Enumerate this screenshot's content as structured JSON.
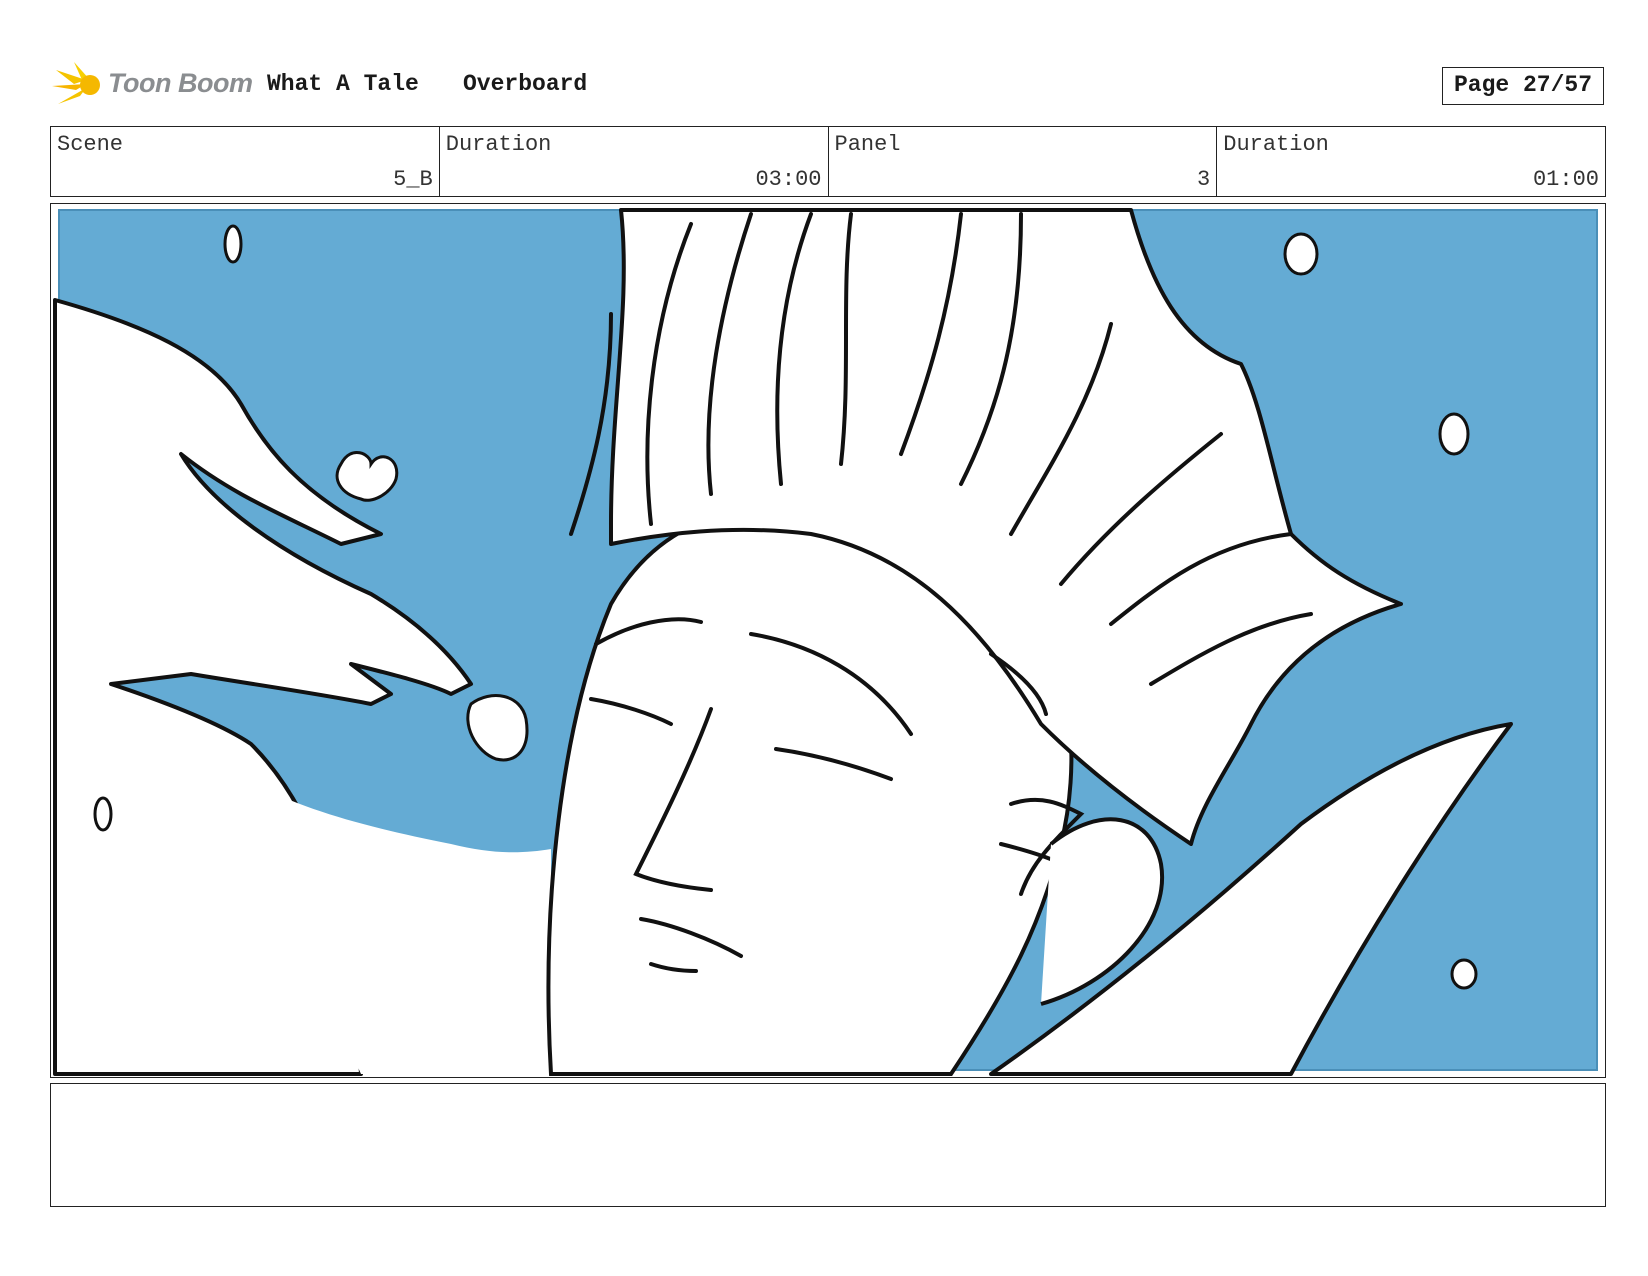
{
  "header": {
    "logo_text": "Toon Boom",
    "project_title": "What A Tale",
    "episode_title": "Overboard",
    "page_label": "Page 27/57"
  },
  "info": {
    "scene_label": "Scene",
    "scene_value": "5_B",
    "scene_duration_label": "Duration",
    "scene_duration_value": "03:00",
    "panel_label": "Panel",
    "panel_value": "3",
    "panel_duration_label": "Duration",
    "panel_duration_value": "01:00"
  },
  "colors": {
    "water": "#64abd4",
    "ink": "#111111",
    "logo_yellow": "#f5c400"
  },
  "notes": {
    "text": ""
  }
}
